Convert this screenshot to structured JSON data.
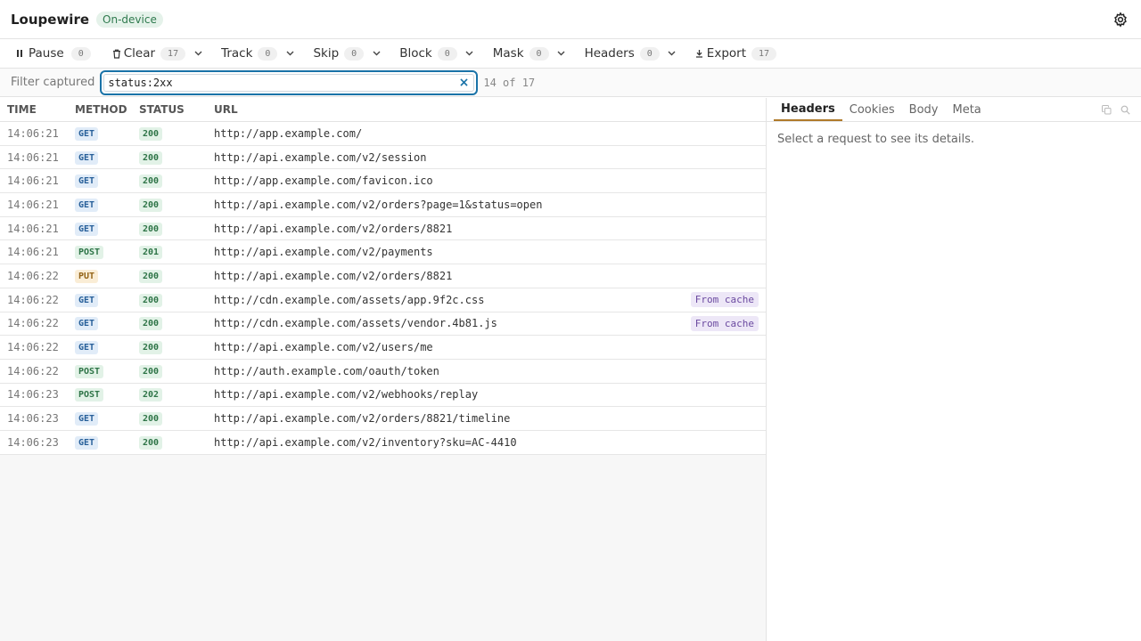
{
  "app": {
    "name": "Loupewire",
    "badge": "On-device"
  },
  "toolbar": {
    "pause": {
      "label": "Pause",
      "count": "0"
    },
    "clear": {
      "label": "Clear",
      "count": "17"
    },
    "track": {
      "label": "Track",
      "count": "0"
    },
    "skip": {
      "label": "Skip",
      "count": "0"
    },
    "block": {
      "label": "Block",
      "count": "0"
    },
    "mask": {
      "label": "Mask",
      "count": "0"
    },
    "headers": {
      "label": "Headers",
      "count": "0"
    },
    "export": {
      "label": "Export",
      "count": "17"
    }
  },
  "filter": {
    "label": "Filter captured",
    "value": "status:2xx",
    "clear_glyph": "×",
    "match_count": "14 of 17"
  },
  "requests": {
    "columns": {
      "time": "TIME",
      "method": "METHOD",
      "status": "STATUS",
      "url": "URL"
    },
    "rows": [
      {
        "time": "14:06:21",
        "method": "GET",
        "status": "200",
        "url": "http://app.example.com/",
        "tag": ""
      },
      {
        "time": "14:06:21",
        "method": "GET",
        "status": "200",
        "url": "http://api.example.com/v2/session",
        "tag": ""
      },
      {
        "time": "14:06:21",
        "method": "GET",
        "status": "200",
        "url": "http://app.example.com/favicon.ico",
        "tag": ""
      },
      {
        "time": "14:06:21",
        "method": "GET",
        "status": "200",
        "url": "http://api.example.com/v2/orders?page=1&status=open",
        "tag": ""
      },
      {
        "time": "14:06:21",
        "method": "GET",
        "status": "200",
        "url": "http://api.example.com/v2/orders/8821",
        "tag": ""
      },
      {
        "time": "14:06:21",
        "method": "POST",
        "status": "201",
        "url": "http://api.example.com/v2/payments",
        "tag": ""
      },
      {
        "time": "14:06:22",
        "method": "PUT",
        "status": "200",
        "url": "http://api.example.com/v2/orders/8821",
        "tag": ""
      },
      {
        "time": "14:06:22",
        "method": "GET",
        "status": "200",
        "url": "http://cdn.example.com/assets/app.9f2c.css",
        "tag": "From cache"
      },
      {
        "time": "14:06:22",
        "method": "GET",
        "status": "200",
        "url": "http://cdn.example.com/assets/vendor.4b81.js",
        "tag": "From cache"
      },
      {
        "time": "14:06:22",
        "method": "GET",
        "status": "200",
        "url": "http://api.example.com/v2/users/me",
        "tag": ""
      },
      {
        "time": "14:06:22",
        "method": "POST",
        "status": "200",
        "url": "http://auth.example.com/oauth/token",
        "tag": ""
      },
      {
        "time": "14:06:23",
        "method": "POST",
        "status": "202",
        "url": "http://api.example.com/v2/webhooks/replay",
        "tag": ""
      },
      {
        "time": "14:06:23",
        "method": "GET",
        "status": "200",
        "url": "http://api.example.com/v2/orders/8821/timeline",
        "tag": ""
      },
      {
        "time": "14:06:23",
        "method": "GET",
        "status": "200",
        "url": "http://api.example.com/v2/inventory?sku=AC-4410",
        "tag": ""
      }
    ]
  },
  "detail": {
    "tabs": [
      "Headers",
      "Cookies",
      "Body",
      "Meta"
    ],
    "active_tab": "Headers",
    "empty_message": "Select a request to see its details."
  },
  "colors": {
    "accent": "#1a73a8",
    "tab_underline": "#b07a2a",
    "badge_green": "#2e7447",
    "badge_blue": "#275f99",
    "badge_amber": "#946418",
    "cache_purple": "#6b4aa0"
  },
  "icons": {
    "settings": "gear-icon",
    "pause": "pause-icon",
    "clear": "trash-icon",
    "export": "download-icon",
    "dropdown": "chevron-down-icon",
    "copy": "copy-icon",
    "search": "search-icon"
  }
}
